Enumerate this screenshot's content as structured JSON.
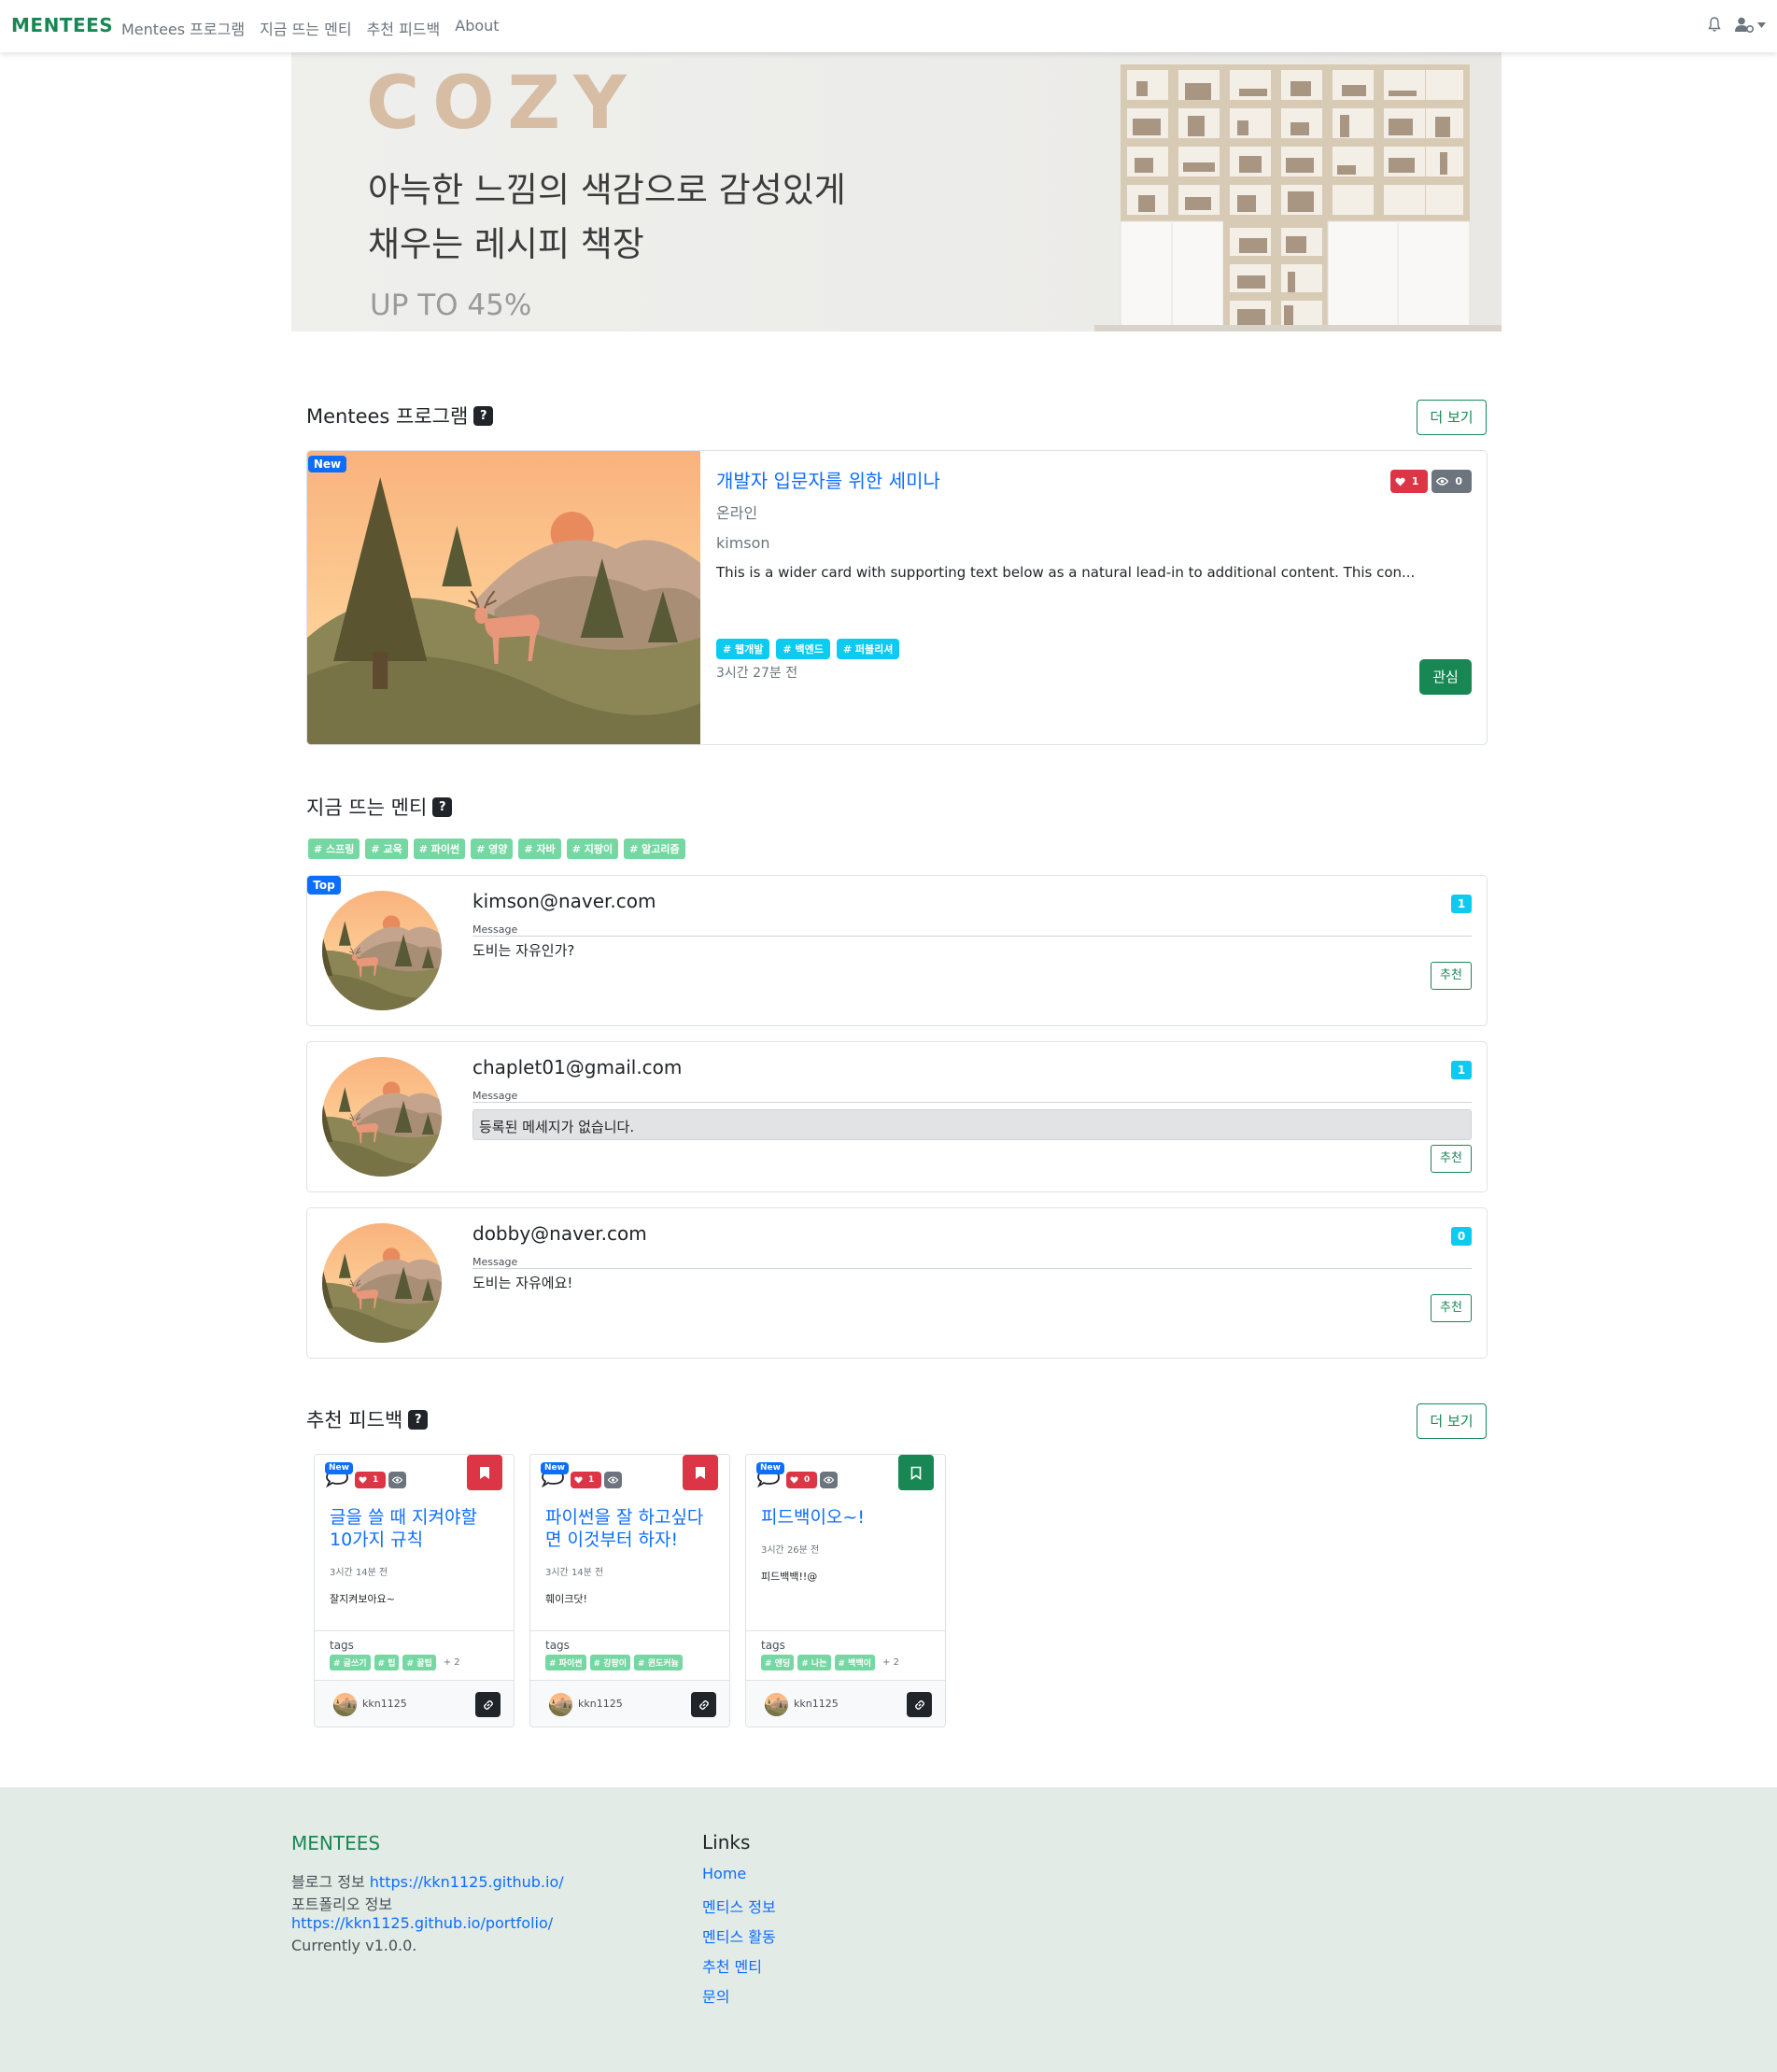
{
  "navbar": {
    "brand": "MENTEES",
    "links": [
      "Mentees 프로그램",
      "지금 뜨는 멘티",
      "추천 피드백",
      "About"
    ],
    "right_icons": [
      "bell-icon",
      "user-gear-icon",
      "caret-down-icon"
    ]
  },
  "banner": {
    "cozy": "COZY",
    "line1": "아늑한 느낌의 색감으로 감성있게",
    "line2": "채우는 레시피 책장",
    "sale": "UP TO 45%"
  },
  "programs": {
    "title": "Mentees 프로그램",
    "help": "?",
    "more": "더 보기",
    "card": {
      "new_badge": "New",
      "title": "개발자 입문자를 위한 세미나",
      "type": "온라인",
      "author": "kimson",
      "description": "This is a wider card with supporting text below as a natural lead-in to additional content. This con...",
      "tags": [
        "# 웹개발",
        "# 백엔드",
        "# 퍼블리셔"
      ],
      "time": "3시간 27분 전",
      "likes": "1",
      "views": "0",
      "interest_button": "관심"
    }
  },
  "hot_mentis": {
    "title": "지금 뜨는 멘티",
    "help": "?",
    "tags": [
      "# 스프링",
      "# 교육",
      "# 파이썬",
      "# 영양",
      "# 자바",
      "# 지팡이",
      "# 알고리즘"
    ],
    "top_badge": "Top",
    "message_label": "Message",
    "recommend_label": "추천",
    "items": [
      {
        "email": "kimson@naver.com",
        "message": "도비는 자유인가?",
        "count": "1"
      },
      {
        "email": "chaplet01@gmail.com",
        "message": "등록된 메세지가 없습니다.",
        "count": "1"
      },
      {
        "email": "dobby@naver.com",
        "message": "도비는 자유에요!",
        "count": "0"
      }
    ]
  },
  "feedback": {
    "title": "추천 피드백",
    "help": "?",
    "more": "더 보기",
    "new_badge": "New",
    "tags_label": "tags",
    "items": [
      {
        "title": "글을 쓸 때 지켜야할 10가지 규칙",
        "time": "3시간 14분 전",
        "body": "잘지켜보아요~",
        "likes": "1",
        "tags": [
          "# 글쓰기",
          "# 팁",
          "# 꿀팁"
        ],
        "more": "+ 2",
        "user": "kkn1125",
        "bookmark_color": "#dc3545",
        "bookmark_filled": true
      },
      {
        "title": "파이썬을 잘 하고싶다면 이것부터 하자!",
        "time": "3시간 14분 전",
        "body": "훼이크닷!",
        "likes": "1",
        "tags": [
          "# 파이썬",
          "# 강팡이",
          "# 윈도커늄"
        ],
        "more": "",
        "user": "kkn1125",
        "bookmark_color": "#dc3545",
        "bookmark_filled": true
      },
      {
        "title": "피드백이오~!",
        "time": "3시간 26분 전",
        "body": "피드백백!!@",
        "likes": "0",
        "tags": [
          "# 엔딩",
          "# 나는",
          "# 백백이"
        ],
        "more": "+ 2",
        "user": "kkn1125",
        "bookmark_color": "#198754",
        "bookmark_filled": false
      }
    ]
  },
  "footer": {
    "brand": "MENTEES",
    "blog_label": "블로그 정보",
    "blog_url": "https://kkn1125.github.io/",
    "portfolio_label": "포트폴리오 정보",
    "portfolio_url": "https://kkn1125.github.io/portfolio/",
    "version": "Currently v1.0.0.",
    "links_title": "Links",
    "links": [
      "Home",
      "멘티스 정보",
      "멘티스 활동",
      "추천 멘티",
      "문의"
    ]
  }
}
